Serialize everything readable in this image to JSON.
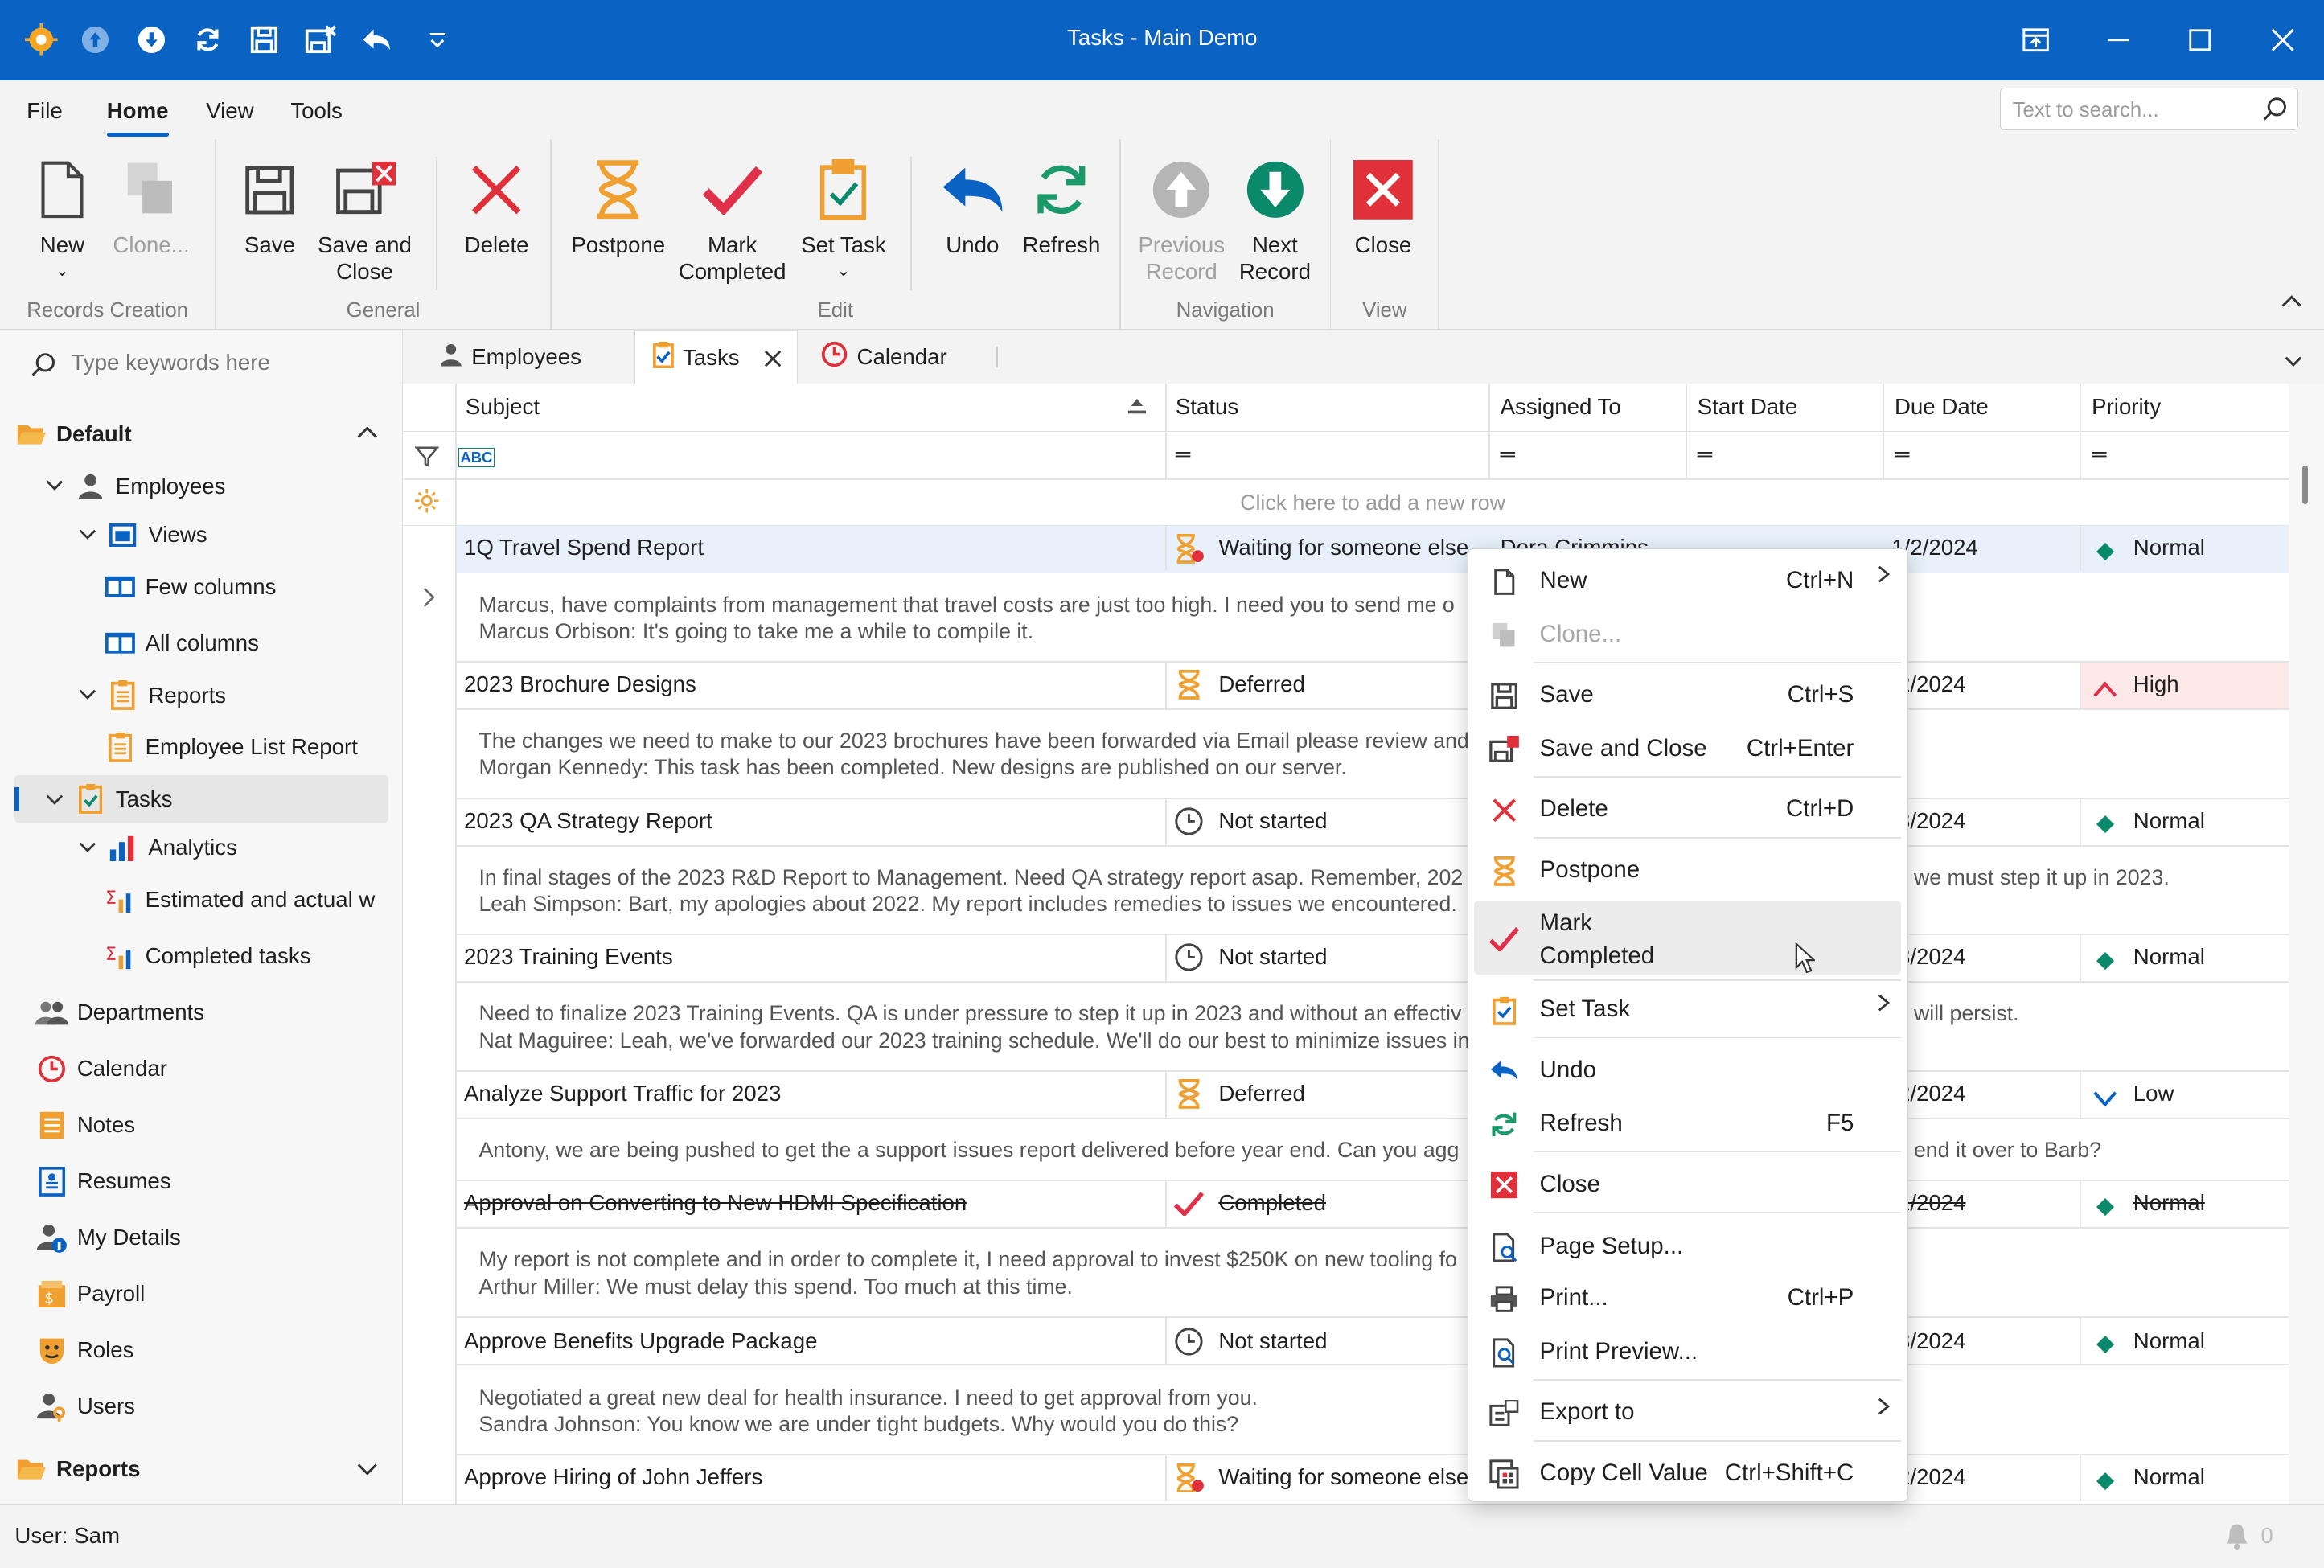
{
  "window": {
    "title": "Tasks - Main Demo"
  },
  "menu": {
    "file": "File",
    "home": "Home",
    "view": "View",
    "tools": "Tools"
  },
  "search": {
    "placeholder": "Text to search..."
  },
  "ribbon": {
    "new": "New",
    "clone": "Clone...",
    "save": "Save",
    "save_close_1": "Save and",
    "save_close_2": "Close",
    "delete": "Delete",
    "postpone": "Postpone",
    "mark_1": "Mark",
    "mark_2": "Completed",
    "set_task": "Set Task",
    "undo": "Undo",
    "refresh": "Refresh",
    "prev_1": "Previous",
    "prev_2": "Record",
    "next_1": "Next",
    "next_2": "Record",
    "close": "Close",
    "groups": {
      "records": "Records Creation",
      "general": "General",
      "edit": "Edit",
      "navigation": "Navigation",
      "view": "View"
    }
  },
  "sidebar": {
    "search_placeholder": "Type keywords here",
    "default": "Default",
    "employees": "Employees",
    "views": "Views",
    "few_columns": "Few columns",
    "all_columns": "All columns",
    "reports": "Reports",
    "employee_list_report": "Employee List Report",
    "tasks": "Tasks",
    "analytics": "Analytics",
    "estimated": "Estimated and actual w",
    "completed_tasks": "Completed tasks",
    "departments": "Departments",
    "calendar": "Calendar",
    "notes": "Notes",
    "resumes": "Resumes",
    "my_details": "My Details",
    "payroll": "Payroll",
    "roles": "Roles",
    "users": "Users",
    "reports_section": "Reports"
  },
  "doc_tabs": {
    "employees": "Employees",
    "tasks": "Tasks",
    "calendar": "Calendar"
  },
  "grid": {
    "columns": {
      "subject": "Subject",
      "status": "Status",
      "assigned": "Assigned To",
      "start": "Start Date",
      "due": "Due Date",
      "priority": "Priority"
    },
    "new_row": "Click here to add a new row",
    "rows": [
      {
        "subject": "1Q Travel Spend Report",
        "status": "Waiting for someone else",
        "assigned": "Dora Crimmins",
        "due": "1/2/2024",
        "priority": "Normal",
        "preview1": "Marcus, have complaints from management that travel costs are just too high. I need you to send me o",
        "preview2": "Marcus Orbison: It's going to take me a while to compile it."
      },
      {
        "subject": "2023 Brochure Designs",
        "status": "Deferred",
        "due": "/2/2024",
        "priority": "High",
        "preview1": "The changes we need to make to our 2023 brochures have been forwarded via Email please review and",
        "preview2": "Morgan Kennedy: This task has been completed. New designs are published on our server."
      },
      {
        "subject": "2023 QA Strategy Report",
        "status": "Not started",
        "due": "/3/2024",
        "priority": "Normal",
        "preview1": "In final stages of the 2023 R&D Report to Management. Need QA strategy report asap. Remember, 202",
        "preview1b": "we must step it up in 2023.",
        "preview2": "Leah Simpson: Bart, my apologies about 2022. My report includes remedies to issues we encountered."
      },
      {
        "subject": "2023 Training Events",
        "status": "Not started",
        "due": "/3/2024",
        "priority": "Normal",
        "preview1": "Need to finalize 2023 Training Events. QA is under pressure to step it up in 2023 and without an effectiv",
        "preview1b": "will persist.",
        "preview2": "Nat Maguiree: Leah, we've forwarded our 2023 training schedule. We'll do our best to minimize issues in"
      },
      {
        "subject": "Analyze Support Traffic for 2023",
        "status": "Deferred",
        "due": "/2/2024",
        "priority": "Low",
        "preview1": "Antony, we are being pushed to get the a support issues report delivered before year end. Can you agg",
        "preview1b": "end it over to Barb?"
      },
      {
        "subject": "Approval on Converting to New HDMI Specification",
        "status": "Completed",
        "due": "/1/2024",
        "priority": "Normal",
        "preview1": "My report is not complete and in order to complete it, I need approval to invest $250K on new tooling fo",
        "preview2": "Arthur Miller: We must delay this spend. Too much at this time."
      },
      {
        "subject": "Approve Benefits Upgrade Package",
        "status": "Not started",
        "due": "/3/2024",
        "priority": "Normal",
        "preview1": "Negotiated a great new deal for health insurance. I need to get approval from you.",
        "preview2": "Sandra Johnson: You know we are under tight budgets. Why would you do this?"
      },
      {
        "subject": "Approve Hiring of John Jeffers",
        "status": "Waiting for someone else",
        "due": "/2/2024",
        "priority": "Normal"
      }
    ]
  },
  "context_menu": {
    "new": "New",
    "new_sc": "Ctrl+N",
    "clone": "Clone...",
    "save": "Save",
    "save_sc": "Ctrl+S",
    "save_close": "Save and Close",
    "save_close_sc": "Ctrl+Enter",
    "delete": "Delete",
    "delete_sc": "Ctrl+D",
    "postpone": "Postpone",
    "mark_1": "Mark",
    "mark_2": "Completed",
    "set_task": "Set Task",
    "undo": "Undo",
    "refresh": "Refresh",
    "refresh_sc": "F5",
    "close": "Close",
    "page_setup": "Page Setup...",
    "print": "Print...",
    "print_sc": "Ctrl+P",
    "print_preview": "Print Preview...",
    "export": "Export to",
    "copy_cell": "Copy Cell Value",
    "copy_cell_sc": "Ctrl+Shift+C"
  },
  "status_bar": {
    "user": "User: Sam",
    "notifications": "0"
  },
  "colors": {
    "accent": "#0a62c2",
    "delete_red": "#e0303a",
    "postpone_orange": "#f0a030",
    "green": "#0a8a6a"
  }
}
